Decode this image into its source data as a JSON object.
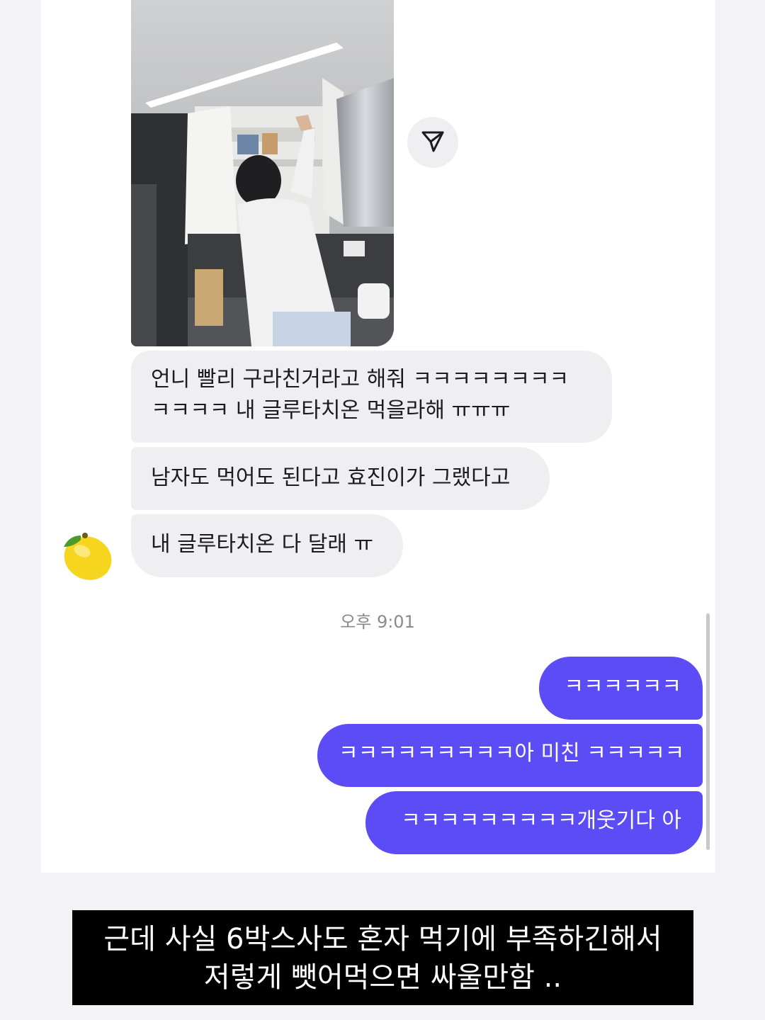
{
  "messages_in": [
    {
      "line1": "언니 빨리 구라친거라고 해줘 ㅋㅋㅋㅋㅋㅋㅋㅋ",
      "line2": "ㅋㅋㅋㅋ 내 글루타치온 먹을라해 ㅠㅠㅠ"
    },
    {
      "text": "남자도 먹어도 된다고 효진이가 그랬다고"
    },
    {
      "text": "내 글루타치온 다 달래 ㅠ"
    }
  ],
  "timestamp": "오후 9:01",
  "messages_out": [
    {
      "text": "ㅋㅋㅋㅋㅋㅋ"
    },
    {
      "text": "ㅋㅋㅋㅋㅋㅋㅋㅋㅋ아 미친 ㅋㅋㅋㅋㅋ"
    },
    {
      "text": "ㅋㅋㅋㅋㅋㅋㅋㅋㅋ개웃기다 아"
    }
  ],
  "caption": {
    "line1": "근데 사실 6박스사도 혼자 먹기에 부족하긴해서",
    "line2": "저렇게 뺏어먹으면 싸울만함 .."
  },
  "icons": {
    "share": "paper-plane-icon",
    "avatar": "lemon-icon"
  },
  "colors": {
    "outgoing_bubble": "#5b4cf5",
    "incoming_bubble": "#efeff1",
    "caption_background": "#000000"
  }
}
